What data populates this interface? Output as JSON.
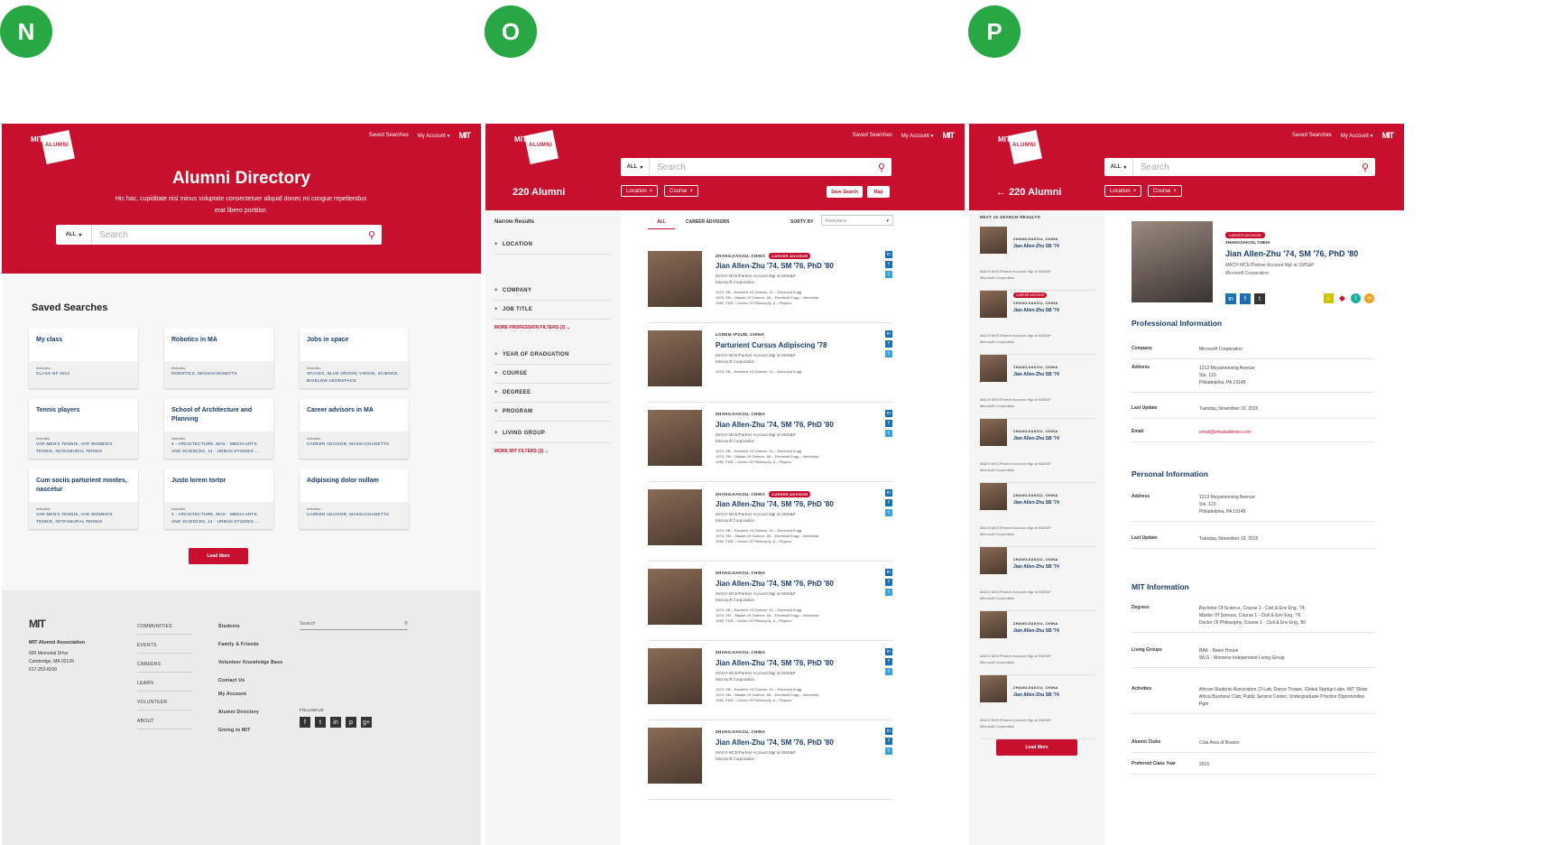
{
  "badges": [
    "N",
    "O",
    "P"
  ],
  "header": {
    "logo_top": "MIT",
    "logo_bottom": "ALUMNI",
    "saved_searches": "Saved Searches",
    "my_account": "My Account",
    "mit_mark": "MIT"
  },
  "search": {
    "scope": "ALL",
    "placeholder": "Search"
  },
  "n": {
    "title": "Alumni Directory",
    "subtitle": "Hic hac, cupiditate nisl minus voluptate consectetuer aliquid donec mi congue repellendus erat libero porttitor.",
    "saved_title": "Saved Searches",
    "includes_label": "Includes:",
    "cards": [
      {
        "title": "My class",
        "includes": "CLASS OF 2012"
      },
      {
        "title": "Robotics in MA",
        "includes": "ROBOTICS, MASSACHUSETTS"
      },
      {
        "title": "Jobs in space",
        "includes": "SPACEX, BLUE ORIGIN, VIRGIN, SCIENCE, BIGELOW AEORSPACE"
      },
      {
        "title": "Tennis players",
        "includes": "VAR MEN'S TENNIS, VAR WOMEN'S TENNIS, INTRAMURAL TENNIS"
      },
      {
        "title": "School of Architecture and Planning",
        "includes": "4 - ARCHITECTURE, MAS - MEDIA ARTS AND SCIENCES, 11 - URBAN STUDIES ..."
      },
      {
        "title": "Career advisors in MA",
        "includes": "CAREER ADVISOR, MASSACHUSETTS"
      },
      {
        "title": "Cum sociis parturient montes, nascetur",
        "includes": "VAR MEN'S TENNIS, VAR WOMEN'S TENNIS, INTRAMURAL TENNIS"
      },
      {
        "title": "Justo lorem tortor",
        "includes": "4 - ARCHITECTURE, MAS - MEDIA ARTS AND SCIENCES, 11 - URBAN STUDIES ..."
      },
      {
        "title": "Adipiscing dolor nullam",
        "includes": "CAREER ADVISOR, MASSACHUSETTS"
      }
    ],
    "load_more": "Load More"
  },
  "footer": {
    "logo": "MIT",
    "org": "MIT Alumni Association",
    "addr1": "600 Memorial Drive",
    "addr2": "Cambridge, MA 02139",
    "phone": "617-253-8200",
    "col1": [
      "COMMUNITIES",
      "EVENTS",
      "CAREERS",
      "LEARN",
      "VOLUNTEER",
      "ABOUT"
    ],
    "col2": [
      "Students",
      "Family & Friends",
      "Volunteer Knowledge Base",
      "Contact Us"
    ],
    "col3": [
      "My Account",
      "Alumni Directory",
      "Giving to MIT"
    ],
    "search_placeholder": "Search",
    "follow": "FOLLOW US"
  },
  "o": {
    "count": "220 Alumni",
    "chips": [
      "Location",
      "Course"
    ],
    "save_search": "Save Search",
    "map": "Map",
    "narrow": "Narrow Results",
    "filters1": [
      "LOCATION",
      "COMPANY",
      "JOB TITLE"
    ],
    "more_prof": "MORE PROFESSION FILTERS (2)",
    "filters2": [
      "YEAR OF GRADUATION",
      "COURSE",
      "DEGREEE",
      "PROGRAM",
      "LIVING GROUP"
    ],
    "more_mit": "MORE MIT FILTERS (2)",
    "tab_all": "ALL",
    "tab_career": "CAREER ADVISORS",
    "sort_by": "SORTY BY",
    "sort_value": "Relevance",
    "career_badge": "CAREER ADVISOR",
    "results": [
      {
        "loc": "ZHANGJIAKOU, CHINA",
        "career": true,
        "name": "Jian Allen-Zhu '74, SM '76, PhD '80",
        "job": "MACH MCE/Partner Account Mgr at SMS&P\nMicrosoft Corporation",
        "deg": "1974, SB – Bachelor Of Science, 61 – Electrical Engg\n1976, SM – Master Of Science, 6A – Electrical Engg – Internship\n1980, PHD – Doctor Of Philosophy, 8 – Physics"
      },
      {
        "loc": "LOREM IPSUM, CHINA",
        "career": false,
        "name": "Parturient Cursus Adipiscing '78",
        "job": "MACH MCE/Partner Account Mgr at SMS&P\nMicrosoft Corporation",
        "deg": "1978, SB – Bachelor Of Science, 61 – Electrical Engg"
      },
      {
        "loc": "ZHANGJIAKOU, CHINA",
        "career": false,
        "name": "Jian Allen-Zhu '74, SM '76, PhD '80",
        "job": "MACH MCE/Partner Account Mgr at SMS&P\nMicrosoft Corporation",
        "deg": "1974, SB – Bachelor Of Science, 61 – Electrical Engg\n1976, SM – Master Of Science, 6A – Electrical Engg – Internship\n1980, PHD – Doctor Of Philosophy, 8 – Physics"
      },
      {
        "loc": "ZHANGJIAKOU, CHINA",
        "career": true,
        "name": "Jian Allen-Zhu '74, SM '76, PhD '80",
        "job": "MACH MCE/Partner Account Mgr at SMS&P\nMicrosoft Corporation",
        "deg": "1974, SB – Bachelor Of Science, 61 – Electrical Engg\n1976, SM – Master Of Science, 6A – Electrical Engg – Internship\n1980, PHD – Doctor Of Philosophy, 8 – Physics"
      },
      {
        "loc": "ZHANGJIAKOU, CHINA",
        "career": false,
        "name": "Jian Allen-Zhu '74, SM '76, PhD '80",
        "job": "MACH MCE/Partner Account Mgr at SMS&P\nMicrosoft Corporation",
        "deg": "1974, SB – Bachelor Of Science, 61 – Electrical Engg\n1976, SM – Master Of Science, 6A – Electrical Engg – Internship\n1980, PHD – Doctor Of Philosophy, 8 – Physics"
      },
      {
        "loc": "ZHANGJIAKOU, CHINA",
        "career": false,
        "name": "Jian Allen-Zhu '74, SM '76, PhD '80",
        "job": "MACH MCE/Partner Account Mgr at SMS&P\nMicrosoft Corporation",
        "deg": "1974, SB – Bachelor Of Science, 61 – Electrical Engg\n1976, SM – Master Of Science, 6A – Electrical Engg – Internship\n1980, PHD – Doctor Of Philosophy, 8 – Physics"
      },
      {
        "loc": "ZHANGJIAKOU, CHINA",
        "career": false,
        "name": "Jian Allen-Zhu '74, SM '76, PhD '80",
        "job": "MACH MCE/Partner Account Mgr at SMS&P\nMicrosoft Corporation",
        "deg": ""
      }
    ]
  },
  "p": {
    "back_count": "220 Alumni",
    "next_label": "NEXT 10 SEARCH RESULTS",
    "list": [
      {
        "career": false
      },
      {
        "career": true
      },
      {
        "career": false
      },
      {
        "career": false
      },
      {
        "career": false
      },
      {
        "career": false
      },
      {
        "career": false
      },
      {
        "career": false
      }
    ],
    "list_loc": "ZHANGJIAKOU, CHINA",
    "list_name": "Jian Allen-Zhu SB '74",
    "list_job": "MACH MCE/Partner Account Mgr at SMS&P\nMicrosoft Corporation",
    "load_more": "Load More",
    "profile": {
      "career": "CAREER ADVISOR",
      "loc": "ZHANGJIAKOU, CHINA",
      "name": "Jian Allen-Zhu '74, SM '76, PhD '80",
      "job": "MACH MCE/Partner Account Mgr at SMS&P\nMicrosoft Corporation"
    },
    "prof_title": "Professional Information",
    "prof_rows": [
      {
        "k": "Company",
        "v": "Microsoft Corporation"
      },
      {
        "k": "Address",
        "v": "1213 Moyamensing Avenue\nSte. 123\nPhiladelphia, PA 19148"
      },
      {
        "k": "Last Update",
        "v": "Tuesday, November 10, 2015"
      },
      {
        "k": "Email",
        "v": "email@emailaddress.com"
      }
    ],
    "pers_title": "Personal Information",
    "pers_rows": [
      {
        "k": "Address",
        "v": "1213 Moyamensing Avenue\nSte. 123\nPhiladelphia, PA 19148"
      },
      {
        "k": "Last Update",
        "v": "Tuesday, November 10, 2015"
      }
    ],
    "mit_title": "MIT Information",
    "mit_rows": [
      {
        "k": "Degrees",
        "v": "Bachelor Of Science, Course 1 - Civil & Env Eng, '74\nMaster Of Science, Course 1 - Civil & Env Eng, '76\nDoctor Of Philosophy, Course 1 - Civil & Env Eng, '80"
      },
      {
        "k": "Living Groups",
        "v": "BAK - Baker House\nWLG - Womens Independent Living Group"
      },
      {
        "k": "Activities",
        "v": "African Students Association, D-Lab, Dance Troupe, Global Startup Labs, MIT Sloan Africa Business Club, Public Service Center, Undergraduate Practice Opportunities Pgm"
      },
      {
        "k": "Alumni Clubs",
        "v": "Club Area of Boston"
      },
      {
        "k": "Preferred Class Year",
        "v": "2015"
      }
    ]
  }
}
